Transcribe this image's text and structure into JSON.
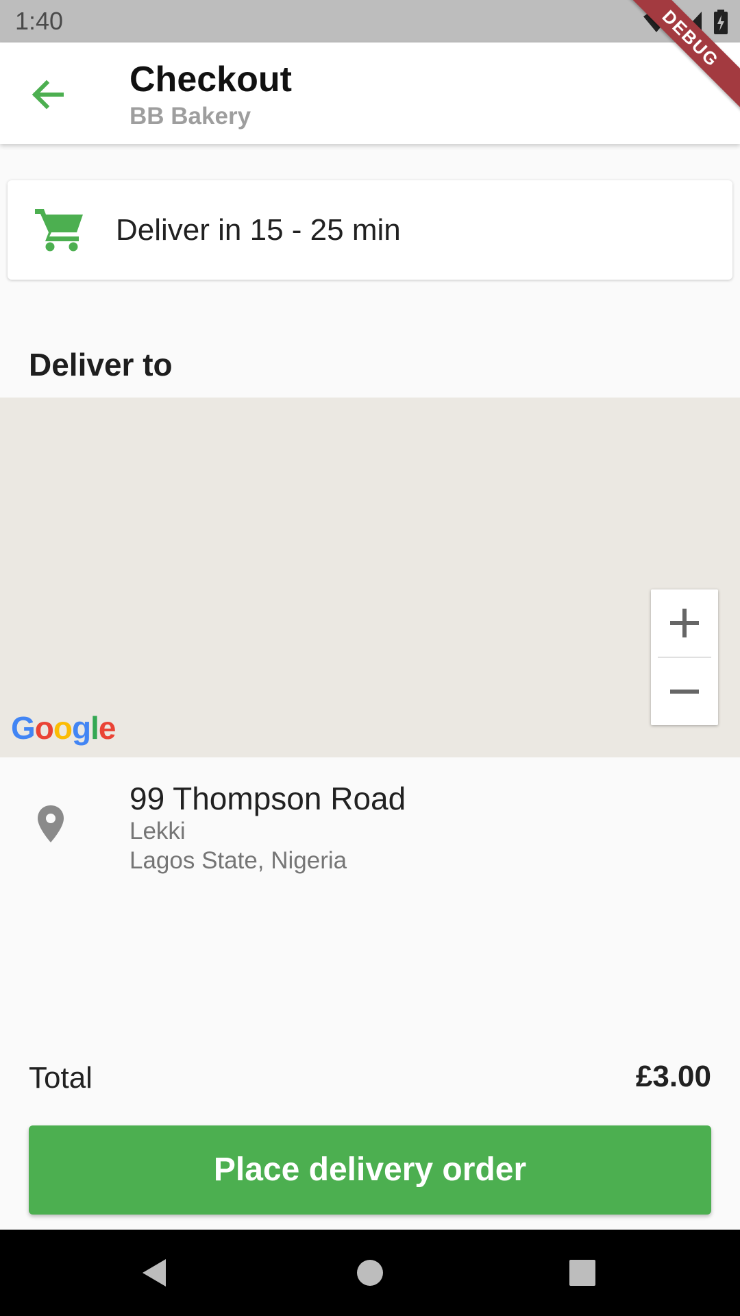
{
  "status_bar": {
    "time": "1:40"
  },
  "debug_banner": "DEBUG",
  "app_bar": {
    "title": "Checkout",
    "subtitle": "BB Bakery"
  },
  "delivery_time": {
    "text": "Deliver in 15 - 25 min",
    "icon": "cart-icon"
  },
  "deliver_to": {
    "heading": "Deliver to"
  },
  "map": {
    "logo": "Google",
    "zoom_in": "+",
    "zoom_out": "−"
  },
  "address": {
    "line1": "99 Thompson Road",
    "line2": "Lekki",
    "line3": "Lagos State, Nigeria",
    "icon": "map-pin-icon"
  },
  "total": {
    "label": "Total",
    "value": "£3.00"
  },
  "place_order": {
    "label": "Place delivery order"
  },
  "colors": {
    "accent": "#4caf50",
    "status_bar": "#bdbdbd",
    "map_bg": "#ebe8e2",
    "debug": "#a33a40"
  }
}
